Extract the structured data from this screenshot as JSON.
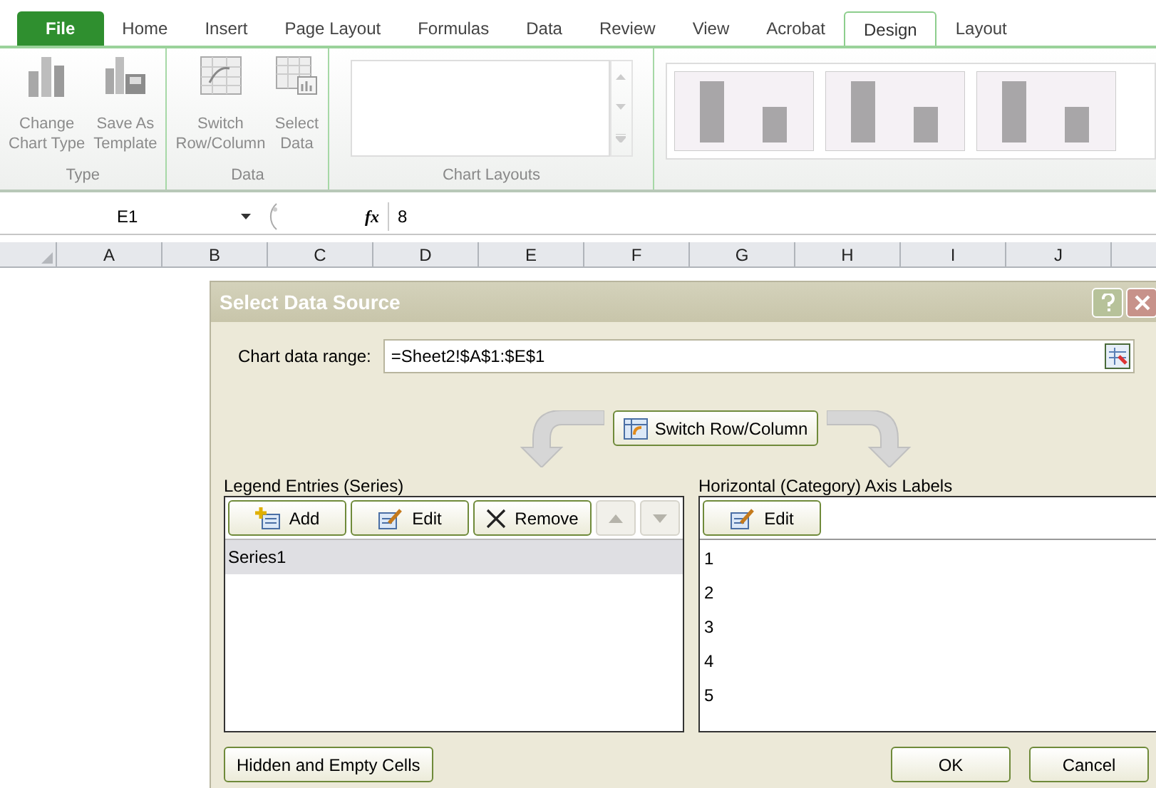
{
  "ribbon_tabs": [
    {
      "label": "File",
      "kind": "file",
      "selected": false
    },
    {
      "label": "Home",
      "kind": "tab",
      "selected": false
    },
    {
      "label": "Insert",
      "kind": "tab",
      "selected": false
    },
    {
      "label": "Page Layout",
      "kind": "tab",
      "selected": false
    },
    {
      "label": "Formulas",
      "kind": "tab",
      "selected": false
    },
    {
      "label": "Data",
      "kind": "tab",
      "selected": false
    },
    {
      "label": "Review",
      "kind": "tab",
      "selected": false
    },
    {
      "label": "View",
      "kind": "tab",
      "selected": false
    },
    {
      "label": "Acrobat",
      "kind": "tab",
      "selected": false
    },
    {
      "label": "Design",
      "kind": "tab",
      "selected": true
    },
    {
      "label": "Layout",
      "kind": "tab",
      "selected": false
    }
  ],
  "ribbon_groups": [
    {
      "label": "Type",
      "buttons": [
        {
          "line1": "Change",
          "line2": "Chart Type",
          "kind": "chart"
        },
        {
          "line1": "Save As",
          "line2": "Template",
          "kind": "save"
        }
      ]
    },
    {
      "label": "Data",
      "buttons": [
        {
          "line1": "Switch",
          "line2": "Row/Column",
          "kind": "switch"
        },
        {
          "line1": "Select",
          "line2": "Data",
          "kind": "select"
        }
      ]
    }
  ],
  "chart_layouts": {
    "label": "Chart Layouts"
  },
  "formula_bar": {
    "name_box": "E1",
    "function_label": "fx",
    "value": "8"
  },
  "columns": [
    "A",
    "B",
    "C",
    "D",
    "E",
    "F",
    "G",
    "H",
    "I",
    "J"
  ],
  "dialog": {
    "title": "Select Data Source",
    "range_label": "Chart data range:",
    "range_value": "=Sheet2!$A$1:$E$1",
    "switch_button": "Switch Row/Column",
    "legend": {
      "title": "Legend Entries (Series)",
      "buttons": [
        {
          "label": "Add",
          "kind": "add",
          "disabled": false
        },
        {
          "label": "Edit",
          "kind": "edit",
          "disabled": false
        },
        {
          "label": "Remove",
          "kind": "remove",
          "disabled": false
        },
        {
          "kind": "up",
          "disabled": true
        },
        {
          "kind": "down",
          "disabled": true
        }
      ],
      "items": [
        {
          "label": "Series1",
          "selected": true
        }
      ]
    },
    "axis": {
      "title": "Horizontal (Category) Axis Labels",
      "buttons": [
        {
          "label": "Edit",
          "kind": "edit",
          "disabled": false
        }
      ],
      "items": [
        {
          "label": "1"
        },
        {
          "label": "2"
        },
        {
          "label": "3"
        },
        {
          "label": "4"
        },
        {
          "label": "5"
        }
      ]
    },
    "hidden_button": "Hidden and Empty Cells",
    "ok": "OK",
    "cancel": "Cancel"
  }
}
